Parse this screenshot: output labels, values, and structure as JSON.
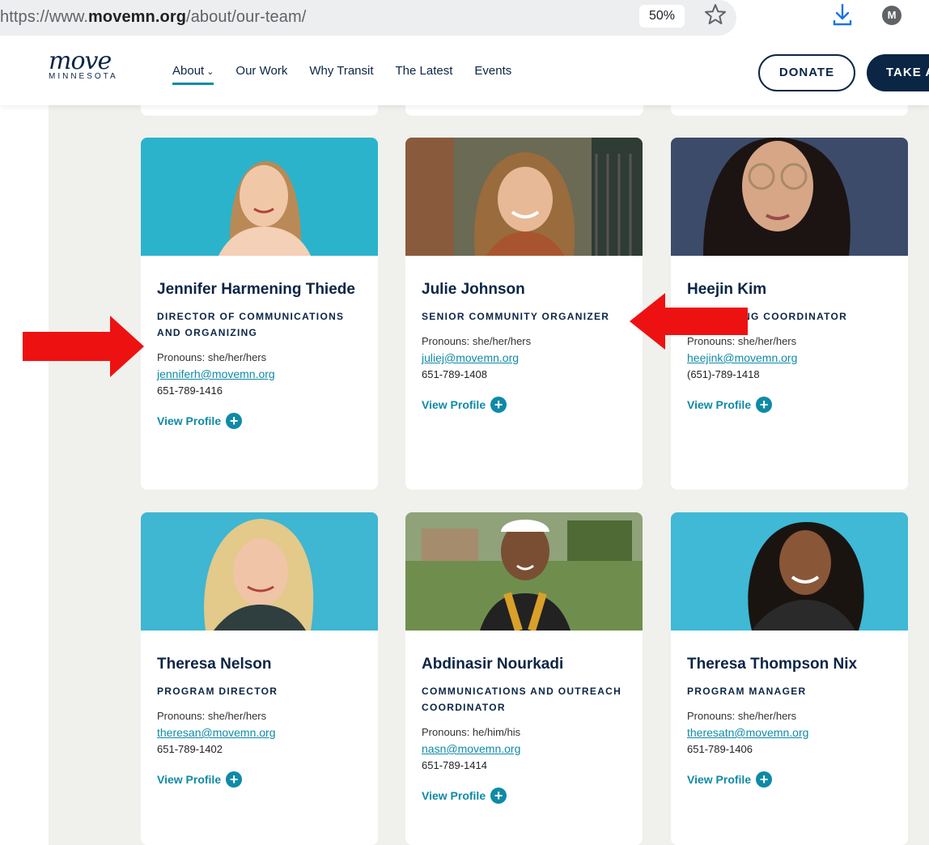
{
  "browser": {
    "url_prefix": "https://www.",
    "url_domain": "movemn.org",
    "url_path": "/about/our-team/",
    "zoom": "50%",
    "account_initial": "M"
  },
  "header": {
    "logo_script": "move",
    "logo_sub": "MINNESOTA",
    "nav": [
      "About",
      "Our Work",
      "Why Transit",
      "The Latest",
      "Events"
    ],
    "donate_label": "DONATE",
    "take_label": "TAKE ACTION"
  },
  "team": [
    {
      "name": "Jennifer Harmening Thiede",
      "title": "DIRECTOR OF COMMUNICATIONS AND ORGANIZING",
      "pronouns": "Pronouns: she/her/hers",
      "email": "jenniferh@movemn.org",
      "phone": "651-789-1416",
      "view": "View Profile",
      "photo_bg": "#2bb3cc"
    },
    {
      "name": "Julie Johnson",
      "title": "SENIOR COMMUNITY ORGANIZER",
      "pronouns": "Pronouns: she/her/hers",
      "email": "juliej@movemn.org",
      "phone": "651-789-1408",
      "view": "View Profile",
      "photo_bg": "#6b6a55"
    },
    {
      "name": "Heejin Kim",
      "title": "ORGANIZING COORDINATOR",
      "pronouns": "Pronouns: she/her/hers",
      "email": "heejink@movemn.org",
      "phone": "(651)-789-1418",
      "view": "View Profile",
      "photo_bg": "#3d4b6a"
    },
    {
      "name": "Theresa Nelson",
      "title": "PROGRAM DIRECTOR",
      "pronouns": "Pronouns: she/her/hers",
      "email": "theresan@movemn.org",
      "phone": "651-789-1402",
      "view": "View Profile",
      "photo_bg": "#3fb6d2"
    },
    {
      "name": "Abdinasir Nourkadi",
      "title": "COMMUNICATIONS AND OUTREACH COORDINATOR",
      "pronouns": "Pronouns: he/him/his",
      "email": "nasn@movemn.org",
      "phone": "651-789-1414",
      "view": "View Profile",
      "photo_bg": "#6f8e4e"
    },
    {
      "name": "Theresa Thompson Nix",
      "title": "PROGRAM MANAGER",
      "pronouns": "Pronouns: she/her/hers",
      "email": "theresatn@movemn.org",
      "phone": "651-789-1406",
      "view": "View Profile",
      "photo_bg": "#3fb9d6"
    }
  ],
  "colors": {
    "navy": "#0b2545",
    "teal": "#0f8aa7",
    "page_bg": "#f0f0ec",
    "annotation_arrow": "#ee1111"
  }
}
